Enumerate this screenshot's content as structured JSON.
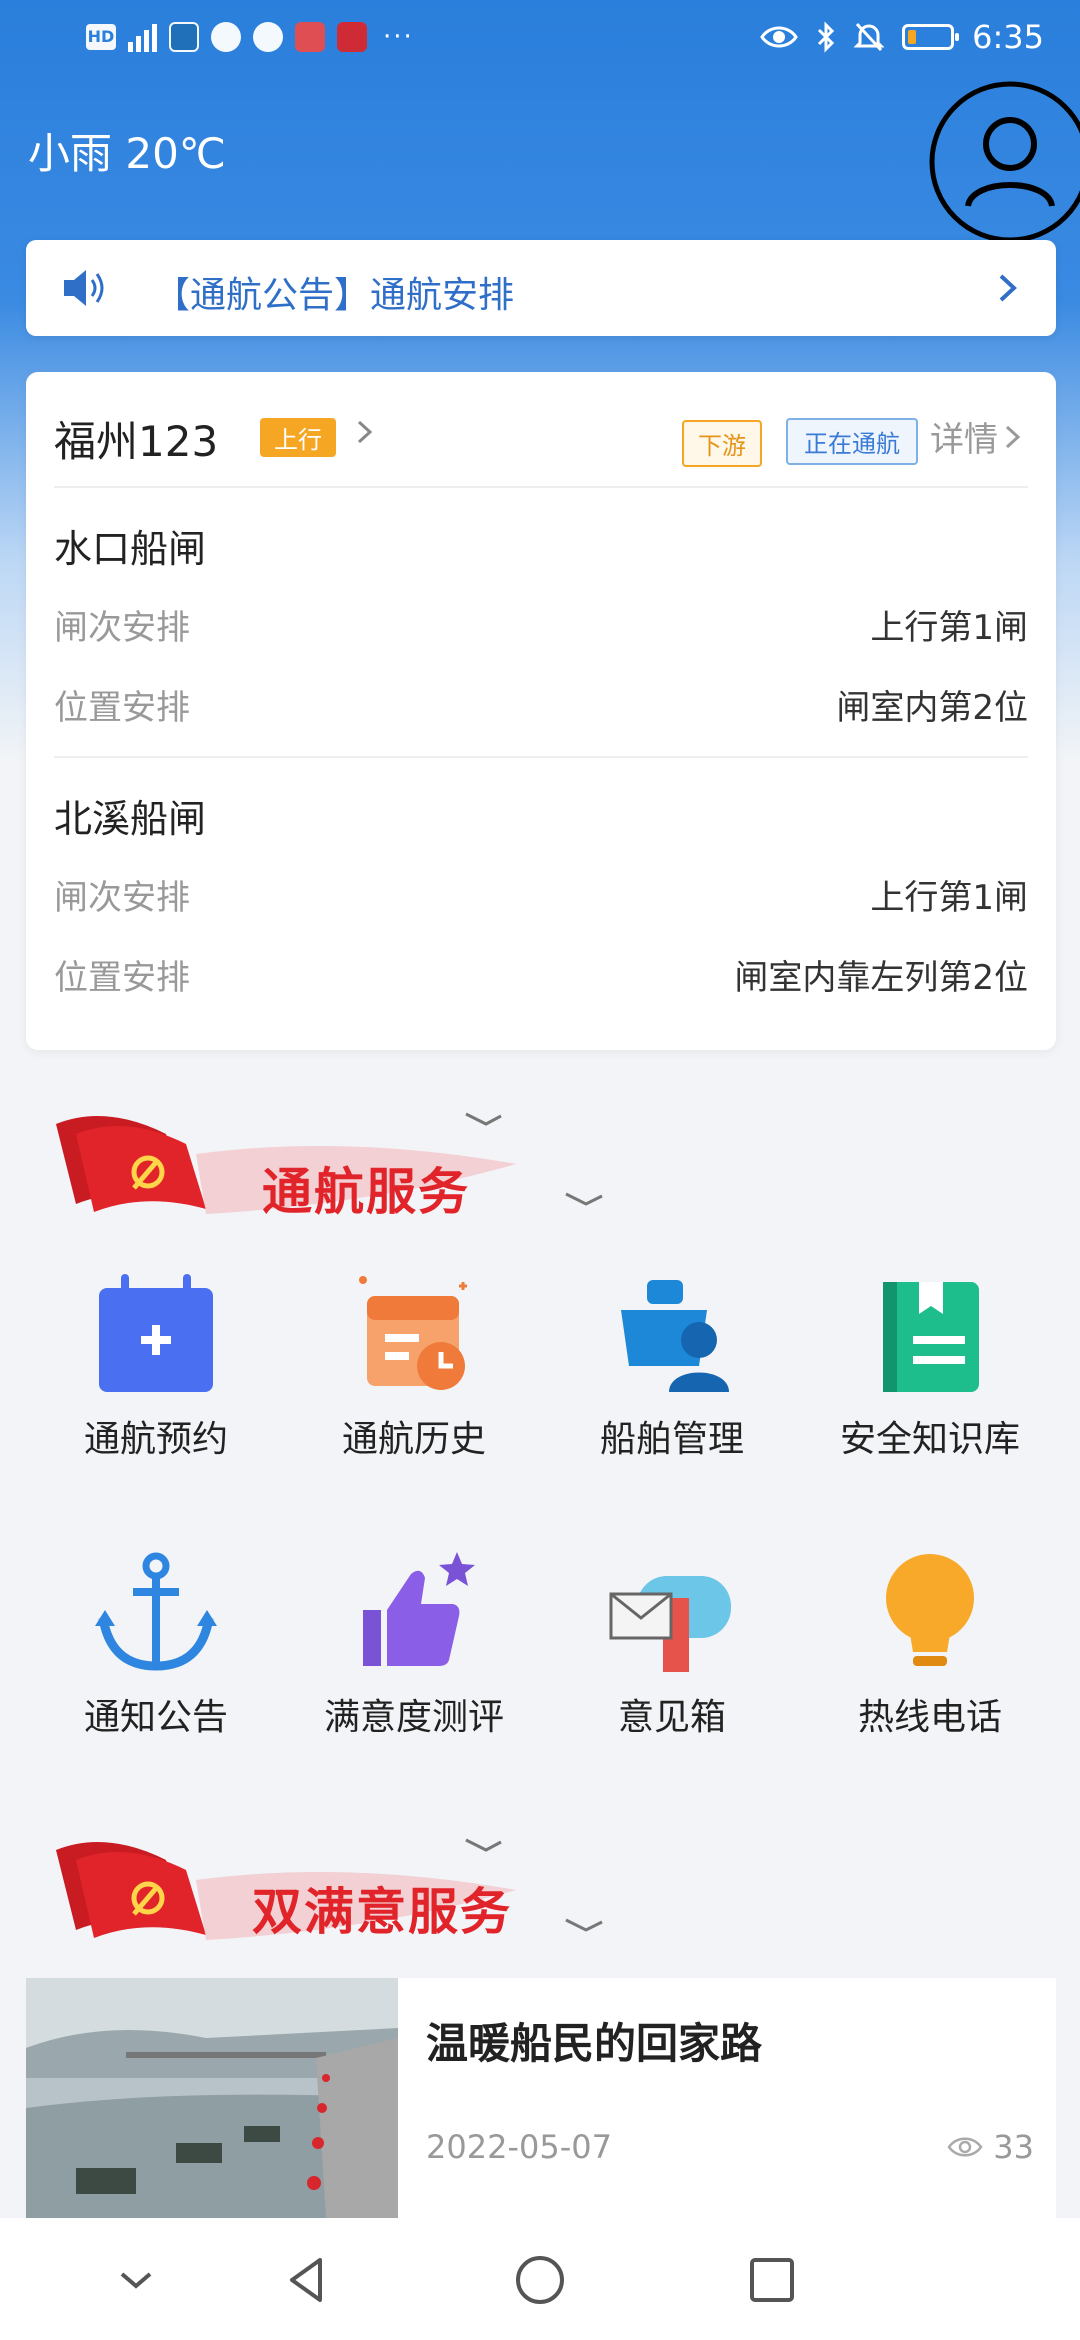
{
  "status_bar": {
    "time": "6:35",
    "battery_level": 0.2,
    "icons": [
      "hd-icon",
      "signal-4g-icon",
      "weather-app-icon",
      "hand-icon",
      "chat-icon",
      "book-icon",
      "study-app-icon",
      "more-dots",
      "eye-icon",
      "bluetooth-icon",
      "mute-icon",
      "battery-icon"
    ]
  },
  "header": {
    "weather": "小雨 20℃",
    "avatar_icon": "user-avatar-icon"
  },
  "notice": {
    "text": "【通航公告】通航安排",
    "color": "#2f6fc8"
  },
  "ship": {
    "name": "福州123",
    "direction": "上行",
    "tag_downstream": "下游",
    "tag_status": "正在通航",
    "detail": "详情",
    "locks": [
      {
        "name": "水口船闸",
        "rows": [
          {
            "label": "闸次安排",
            "value": "上行第1闸"
          },
          {
            "label": "位置安排",
            "value": "闸室内第2位"
          }
        ]
      },
      {
        "name": "北溪船闸",
        "rows": [
          {
            "label": "闸次安排",
            "value": "上行第1闸"
          },
          {
            "label": "位置安排",
            "value": "闸室内靠左列第2位"
          }
        ]
      }
    ]
  },
  "sections": {
    "service_title": "通航服务",
    "satisfaction_title": "双满意服务"
  },
  "services": [
    {
      "label": "通航预约",
      "icon": "calendar-plus-icon"
    },
    {
      "label": "通航历史",
      "icon": "calendar-clock-icon"
    },
    {
      "label": "船舶管理",
      "icon": "ship-person-icon"
    },
    {
      "label": "安全知识库",
      "icon": "bookmark-book-icon"
    },
    {
      "label": "通知公告",
      "icon": "anchor-icon"
    },
    {
      "label": "满意度测评",
      "icon": "thumbs-up-star-icon"
    },
    {
      "label": "意见箱",
      "icon": "mailbox-icon"
    },
    {
      "label": "热线电话",
      "icon": "lightbulb-icon"
    }
  ],
  "article": {
    "title": "温暖船民的回家路",
    "date": "2022-05-07",
    "views": "33"
  },
  "colors": {
    "primary": "#2a7fdc",
    "orange": "#f5a623",
    "red": "#e0242a"
  }
}
